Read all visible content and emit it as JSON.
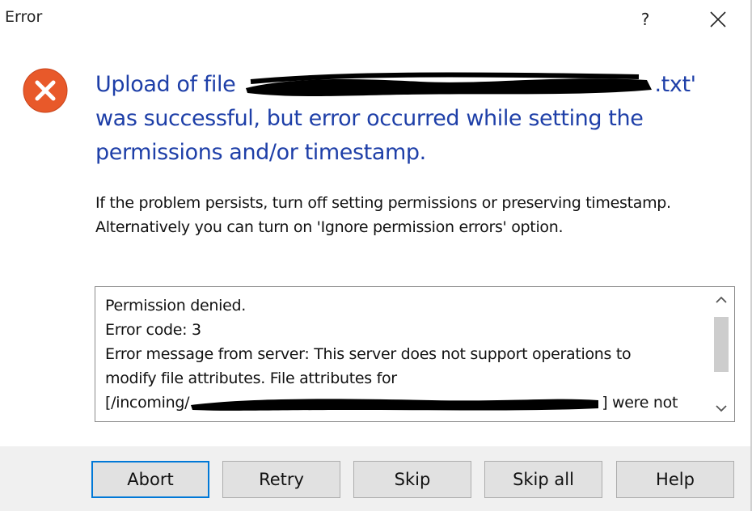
{
  "window": {
    "title": "Error"
  },
  "titlebar": {
    "help_label": "?"
  },
  "message": {
    "instruction_prefix": "Upload of file ",
    "instruction_suffix": ".txt' was successful, but error occurred while setting the permissions and/or timestamp.",
    "content": "If the problem persists, turn off setting permissions or preserving timestamp. Alternatively you can turn on 'Ignore permission errors' option."
  },
  "details": {
    "line1": "Permission denied.",
    "line2": "Error code: 3",
    "line3": "Error message from server: This server does not support operations to",
    "line4": "modify file attributes. File attributes for",
    "line5_prefix": "[/incoming/",
    "line5_suffix": "] were not"
  },
  "buttons": {
    "abort": "Abort",
    "retry": "Retry",
    "skip": "Skip",
    "skip_all": "Skip all",
    "help": "Help"
  },
  "colors": {
    "instruction": "#1e3fa8",
    "error_icon": "#e8592a",
    "default_button_border": "#0078d7",
    "footer_bg": "#f0f0f0"
  },
  "icons": {
    "error": "error-circle-x-icon",
    "close": "close-icon",
    "scroll_up": "chevron-up-icon",
    "scroll_down": "chevron-down-icon"
  }
}
